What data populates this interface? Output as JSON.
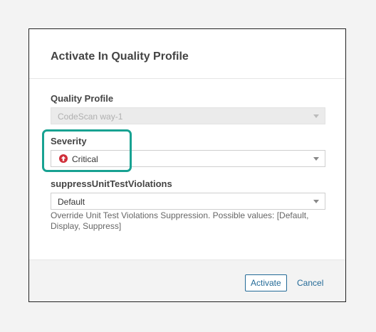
{
  "dialog": {
    "title": "Activate In Quality Profile"
  },
  "fields": {
    "quality_profile": {
      "label": "Quality Profile",
      "value": "CodeScan way-1"
    },
    "severity": {
      "label": "Severity",
      "value": "Critical",
      "icon": "severity-critical-icon",
      "icon_color": "#d02f3a"
    },
    "suppress": {
      "label": "suppressUnitTestViolations",
      "value": "Default",
      "help": "Override Unit Test Violations Suppression. Possible values: [Default, Display, Suppress]"
    }
  },
  "footer": {
    "activate_label": "Activate",
    "cancel_label": "Cancel"
  },
  "colors": {
    "highlight": "#18a292",
    "link": "#236a97",
    "critical": "#d02f3a"
  }
}
